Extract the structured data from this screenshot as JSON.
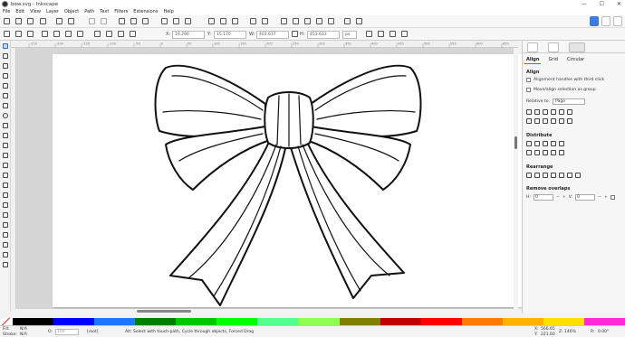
{
  "window": {
    "title": "bow.svg - Inkscape",
    "minimize": "—",
    "maximize": "☐",
    "close": "✕"
  },
  "menu": [
    "File",
    "Edit",
    "View",
    "Layer",
    "Object",
    "Path",
    "Text",
    "Filters",
    "Extensions",
    "Help"
  ],
  "tool_controls": {
    "x_label": "X:",
    "x_value": "19.290",
    "y_label": "Y:",
    "y_value": "15.170",
    "w_label": "W:",
    "w_value": "403.677",
    "h_label": "H:",
    "h_value": "453.633",
    "unit": "px"
  },
  "ruler_ticks": [
    "-250",
    "-200",
    "-150",
    "-100",
    "-50",
    "0",
    "50",
    "100",
    "150",
    "200",
    "250",
    "300",
    "350",
    "400",
    "450",
    "500",
    "550",
    "600",
    "650"
  ],
  "dock": {
    "tabs": [
      "Align",
      "Grid",
      "Circular"
    ],
    "align_heading": "Align",
    "opt_handles": "Alignment handles with third click",
    "opt_move": "Move/align selection as group",
    "relative_label": "Relative to:",
    "relative_value": "Page",
    "distribute_heading": "Distribute",
    "rearrange_heading": "Rearrange",
    "remove_overlaps_heading": "Remove overlaps",
    "h_label": "H:",
    "h_value": "0",
    "v_label": "V:",
    "v_value": "0"
  },
  "palette": [
    "#000000",
    "#0000ff",
    "#1e78ff",
    "#008000",
    "#00c800",
    "#00ff00",
    "#52ff8f",
    "#8fff52",
    "#808000",
    "#c00000",
    "#ff0000",
    "#ff7a00",
    "#ffb300",
    "#ffe000",
    "#ff2ad4"
  ],
  "status": {
    "fill_label": "Fill:",
    "fill_value": "N/A",
    "stroke_label": "Stroke:",
    "stroke_value": "N/A",
    "opacity_label": "O:",
    "opacity_value": "100",
    "layer": "[root]",
    "message": "Alt: Select with touch-path, Cycle through objects, Forced Drag",
    "x_label": "X:",
    "x_value": "566.65",
    "y_label": "Y:",
    "y_value": "221.60",
    "zoom_label": "Z:",
    "zoom_value": "146%",
    "rotation_label": "R:",
    "rotation_value": "0.00°"
  }
}
